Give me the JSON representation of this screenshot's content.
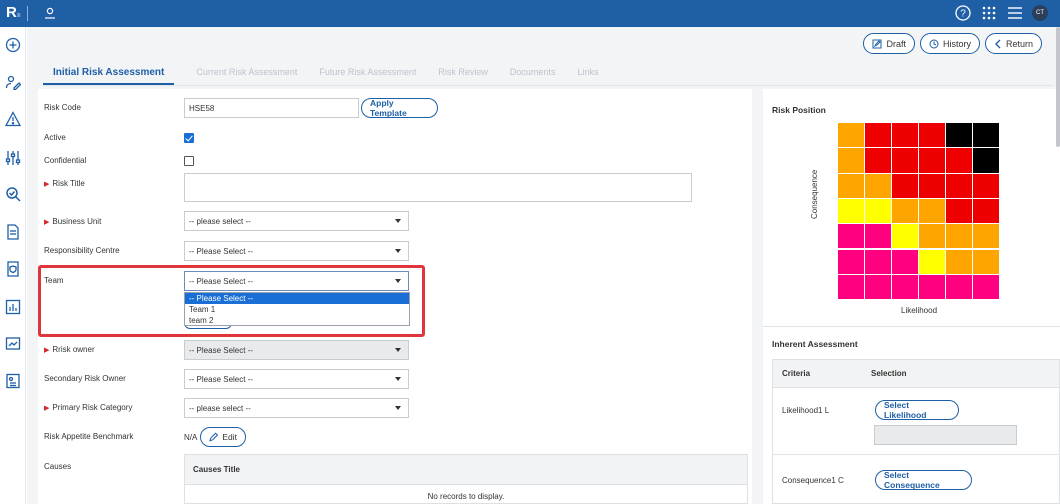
{
  "app": {
    "logo": "R",
    "logo_sub": "≡",
    "avatar_initials": "CT"
  },
  "actions": {
    "draft": "Draft",
    "history": "History",
    "return": "Return"
  },
  "tabs": [
    {
      "label": "Initial Risk Assessment",
      "active": true
    },
    {
      "label": "Current Risk Assessment"
    },
    {
      "label": "Future Risk Assessment"
    },
    {
      "label": "Risk Review"
    },
    {
      "label": "Documents"
    },
    {
      "label": "Links"
    }
  ],
  "form": {
    "risk_code_label": "Risk Code",
    "risk_code_value": "HSE58",
    "apply_template": "Apply Template",
    "active_label": "Active",
    "active_checked": true,
    "confidential_label": "Confidential",
    "confidential_checked": false,
    "risk_title_label": "Risk Title",
    "risk_title_value": "",
    "business_unit_label": "Business Unit",
    "business_unit_value": "-- please select --",
    "responsibility_centre_label": "Responsibility Centre",
    "responsibility_centre_value": "-- Please Select --",
    "team_label": "Team",
    "team_value": "-- Please Select --",
    "team_options": [
      "-- Please Select --",
      "Team 1",
      "team 2"
    ],
    "risk_owner_label": "Rrisk owner",
    "risk_owner_value": "-- Please Select --",
    "secondary_owner_label": "Secondary Risk Owner",
    "secondary_owner_value": "-- Please Select --",
    "primary_category_label": "Primary Risk Category",
    "primary_category_value": "-- please select --",
    "appetite_label": "Risk Appetite Benchmark",
    "appetite_value": "N/A",
    "edit_label": "Edit",
    "causes_label": "Causes",
    "causes_title": "Causes Title",
    "causes_empty": "No records to display."
  },
  "risk_position": {
    "title": "Risk Position",
    "y_label": "Consequence",
    "x_label": "Likelihood",
    "grid": [
      [
        "#ffa500",
        "#ee0000",
        "#ee0000",
        "#ee0000",
        "#000000",
        "#000000"
      ],
      [
        "#ffa500",
        "#ee0000",
        "#ee0000",
        "#ee0000",
        "#ee0000",
        "#000000"
      ],
      [
        "#ffa500",
        "#ffa500",
        "#ee0000",
        "#ee0000",
        "#ee0000",
        "#ee0000"
      ],
      [
        "#ffff00",
        "#ffff00",
        "#ffa500",
        "#ffa500",
        "#ee0000",
        "#ee0000"
      ],
      [
        "#ff0080",
        "#ff0080",
        "#ffff00",
        "#ffa500",
        "#ffa500",
        "#ffa500"
      ],
      [
        "#ff0080",
        "#ff0080",
        "#ff0080",
        "#ffff00",
        "#ffa500",
        "#ffa500"
      ],
      [
        "#ff0080",
        "#ff0080",
        "#ff0080",
        "#ff0080",
        "#ff0080",
        "#ff0080"
      ]
    ]
  },
  "inherent": {
    "title": "Inherent Assessment",
    "col_criteria": "Criteria",
    "col_selection": "Selection",
    "likelihood_label": "Likelihood1 L",
    "likelihood_btn": "Select Likelihood",
    "consequence_label": "Consequence1 C",
    "consequence_btn": "Select Consequence"
  }
}
